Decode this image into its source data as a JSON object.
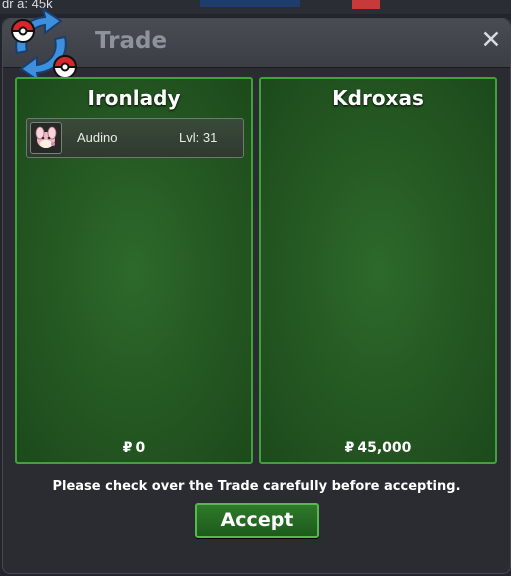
{
  "background": {
    "text": "dr    a:  45k"
  },
  "window": {
    "title": "Trade",
    "close_label": "✕"
  },
  "trade": {
    "left": {
      "name": "Ironlady",
      "currency_symbol": "₽",
      "money": "0",
      "pokemon": [
        {
          "name": "Audino",
          "level": "Lvl: 31",
          "icon": "audino-icon"
        }
      ]
    },
    "right": {
      "name": "Kdroxas",
      "currency_symbol": "₽",
      "money": "45,000",
      "pokemon": []
    }
  },
  "footer": {
    "notice": "Please check over the Trade carefully before accepting.",
    "accept_label": "Accept"
  },
  "colors": {
    "panel_green": "#245722",
    "panel_border": "#3fa23a",
    "window_bg": "#2a2c31",
    "title_text": "#8e939b",
    "accept_border": "#57b84f"
  }
}
